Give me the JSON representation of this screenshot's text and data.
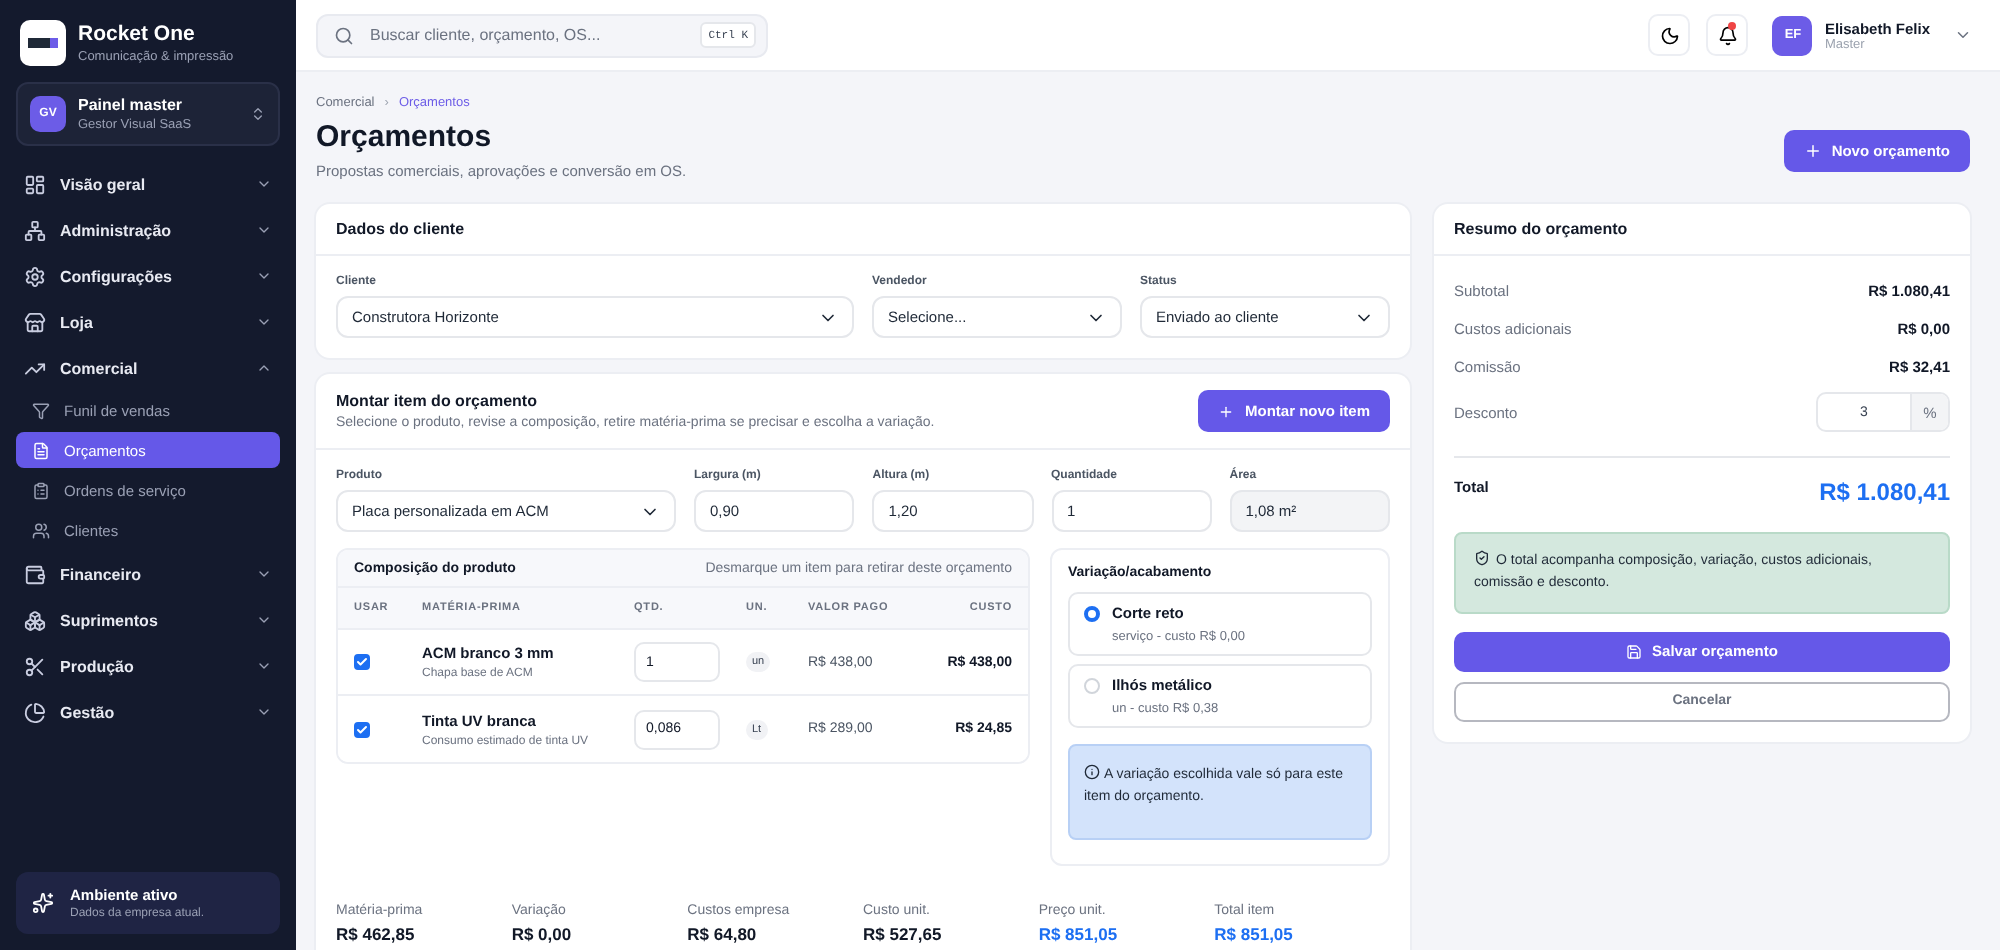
{
  "sidebar": {
    "brand": {
      "name": "Rocket One",
      "tagline": "Comunicação & impressão"
    },
    "workspace": {
      "initials": "GV",
      "name": "Painel master",
      "subtitle": "Gestor Visual SaaS"
    },
    "nav": [
      {
        "label": "Visão geral",
        "expanded": false
      },
      {
        "label": "Administração",
        "expanded": false
      },
      {
        "label": "Configurações",
        "expanded": false
      },
      {
        "label": "Loja",
        "expanded": false
      },
      {
        "label": "Comercial",
        "expanded": true,
        "children": [
          {
            "label": "Funil de vendas",
            "selected": false
          },
          {
            "label": "Orçamentos",
            "selected": true
          },
          {
            "label": "Ordens de serviço",
            "selected": false
          },
          {
            "label": "Clientes",
            "selected": false
          }
        ]
      },
      {
        "label": "Financeiro",
        "expanded": false
      },
      {
        "label": "Suprimentos",
        "expanded": false
      },
      {
        "label": "Produção",
        "expanded": false
      },
      {
        "label": "Gestão",
        "expanded": false
      }
    ],
    "footer": {
      "title": "Ambiente ativo",
      "text": "Dados da empresa atual."
    }
  },
  "topbar": {
    "search": {
      "placeholder": "Buscar cliente, orçamento, OS...",
      "shortcut": "Ctrl K"
    },
    "notifications": {
      "unread": true
    },
    "user": {
      "initials": "EF",
      "name": "Elisabeth Felix",
      "role": "Master"
    }
  },
  "page": {
    "breadcrumb": [
      {
        "label": "Comercial",
        "selected": false
      },
      {
        "label": "Orçamentos",
        "selected": true
      }
    ],
    "separator": "›",
    "title": "Orçamentos",
    "subtitle": "Propostas comerciais, aprovações e conversão em OS.",
    "new_button": "Novo orçamento"
  },
  "client_card": {
    "title": "Dados do cliente",
    "fields": [
      {
        "label": "Cliente",
        "value": "Construtora Horizonte",
        "kind": "select"
      },
      {
        "label": "Vendedor",
        "value": "Selecione...",
        "kind": "select"
      },
      {
        "label": "Status",
        "value": "Enviado ao cliente",
        "kind": "select"
      }
    ]
  },
  "item_card": {
    "title": "Montar item do orçamento",
    "description": "Selecione o produto, revise a composição, retire matéria-prima se precisar e escolha a variação.",
    "add_button": "Montar novo item",
    "fields": [
      {
        "label": "Produto",
        "value": "Placa personalizada em ACM",
        "kind": "select"
      },
      {
        "label": "Largura (m)",
        "value": "0,90",
        "kind": "input"
      },
      {
        "label": "Altura (m)",
        "value": "1,20",
        "kind": "input"
      },
      {
        "label": "Quantidade",
        "value": "1",
        "kind": "input"
      },
      {
        "label": "Área",
        "value": "1,08 m²",
        "kind": "readonly"
      }
    ],
    "composition": {
      "title": "Composição do produto",
      "hint": "Desmarque um item para retirar deste orçamento",
      "columns": [
        "USAR",
        "MATÉRIA-PRIMA",
        "QTD.",
        "UN.",
        "VALOR PAGO",
        "CUSTO"
      ],
      "rows": [
        {
          "checked": true,
          "name": "ACM branco 3 mm",
          "description": "Chapa base de ACM",
          "qty": "1",
          "unit": "un",
          "paid": "R$ 438,00",
          "cost": "R$ 438,00"
        },
        {
          "checked": true,
          "name": "Tinta UV branca",
          "description": "Consumo estimado de tinta UV",
          "qty": "0,086",
          "unit": "Lt",
          "paid": "R$ 289,00",
          "cost": "R$ 24,85"
        }
      ]
    },
    "variation": {
      "title": "Variação/acabamento",
      "options": [
        {
          "name": "Corte reto",
          "detail": "serviço - custo R$ 0,00",
          "selected": true
        },
        {
          "name": "Ilhós metálico",
          "detail": "un - custo R$ 0,38",
          "selected": false
        }
      ],
      "note": "A variação escolhida vale só para este item do orçamento."
    },
    "totals": [
      {
        "label": "Matéria-prima",
        "value": "R$ 462,85",
        "highlight": false
      },
      {
        "label": "Variação",
        "value": "R$ 0,00",
        "highlight": false
      },
      {
        "label": "Custos empresa",
        "value": "R$ 64,80",
        "highlight": false
      },
      {
        "label": "Custo unit.",
        "value": "R$ 527,65",
        "highlight": false
      },
      {
        "label": "Preço unit.",
        "value": "R$ 851,05",
        "highlight": true
      },
      {
        "label": "Total item",
        "value": "R$ 851,05",
        "highlight": true
      }
    ]
  },
  "summary": {
    "title": "Resumo do orçamento",
    "lines": [
      {
        "label": "Subtotal",
        "value": "R$ 1.080,41"
      },
      {
        "label": "Custos adicionais",
        "value": "R$ 0,00"
      },
      {
        "label": "Comissão",
        "value": "R$ 32,41"
      }
    ],
    "discount": {
      "label": "Desconto",
      "value": "3",
      "unit": "%"
    },
    "total": {
      "label": "Total",
      "value": "R$ 1.080,41"
    },
    "note": "O total acompanha composição, variação, custos adicionais, comissão e desconto.",
    "save_button": "Salvar orçamento",
    "cancel_button": "Cancelar"
  }
}
